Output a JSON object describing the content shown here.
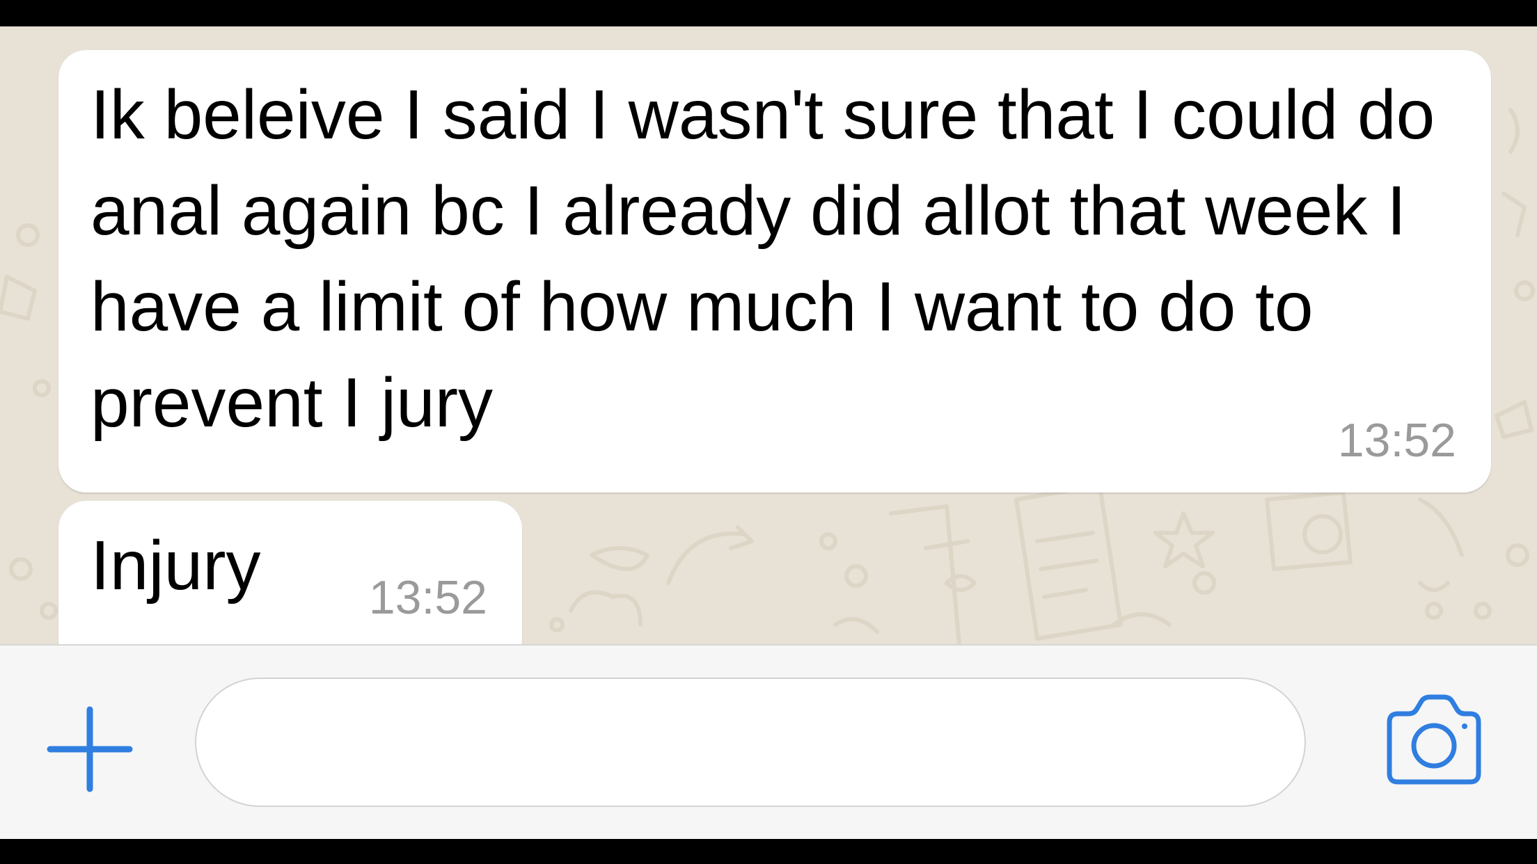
{
  "chat": {
    "messages": [
      {
        "text": "Ik beleive I said I wasn't sure that I could do anal again bc I already did allot that week I have a limit of how much I want to do to prevent I jury",
        "time": "13:52"
      },
      {
        "text": "Injury",
        "time": "13:52"
      }
    ]
  },
  "input_bar": {
    "placeholder": "",
    "value": "",
    "plus_icon": "plus-icon",
    "camera_icon": "camera-icon"
  },
  "colors": {
    "accent": "#2f7ee0",
    "wallpaper": "#e8e2d6",
    "bubble": "#ffffff",
    "timestamp": "#9a9a9a"
  }
}
